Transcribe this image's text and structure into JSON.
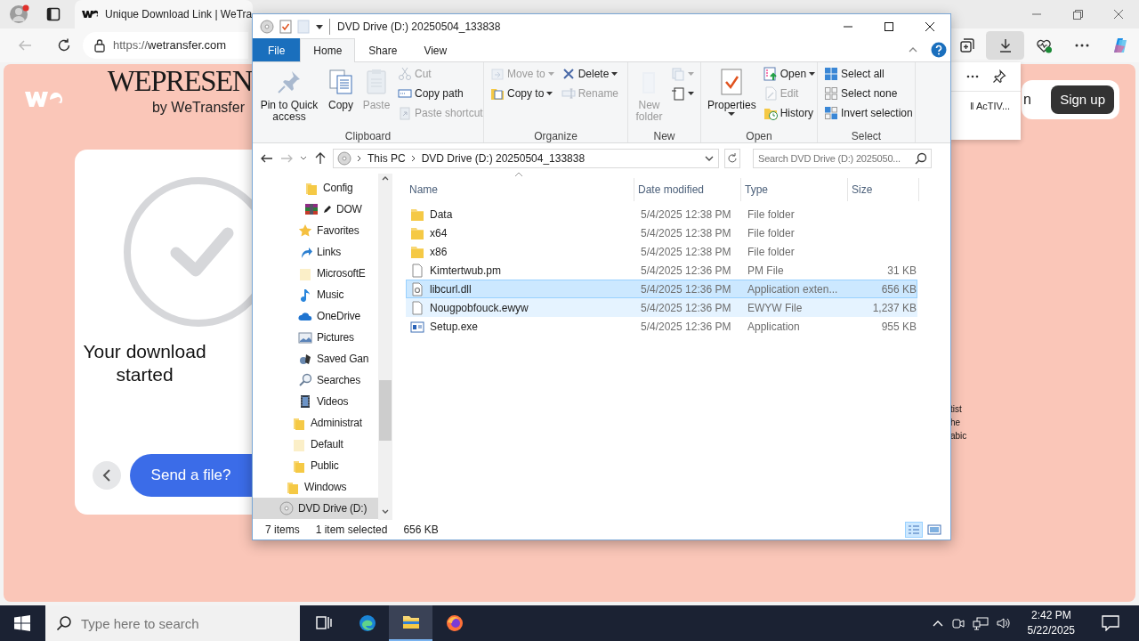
{
  "browser": {
    "tab_title": "Unique Download Link | WeTra",
    "url_scheme": "https://",
    "url_host": "wetransfer.com",
    "page": {
      "brand_title": "WEPRESEN",
      "brand_sub": "by WeTransfer",
      "heading": "Your download started",
      "send_button": "Send a file?",
      "header_partial": "n",
      "signup_button": "Sign up",
      "side_text": [
        "tist",
        "he",
        "abic"
      ]
    },
    "downloads_flyout": {
      "item": "‖ AcTIV..."
    }
  },
  "explorer": {
    "title": "DVD Drive (D:) 20250504_133838",
    "tabs": [
      {
        "label": "File",
        "kind": "file",
        "selected": false
      },
      {
        "label": "Home",
        "kind": "tab",
        "selected": true
      },
      {
        "label": "Share",
        "kind": "tab",
        "selected": false
      },
      {
        "label": "View",
        "kind": "tab",
        "selected": false
      }
    ],
    "ribbon": [
      {
        "label": "Clipboard",
        "columns": [
          [
            {
              "label": "Pin to Quick access",
              "kind": "large",
              "disabled": false,
              "dropdown": false
            }
          ],
          [
            {
              "label": "Copy",
              "kind": "large",
              "disabled": false,
              "dropdown": false
            }
          ],
          [
            {
              "label": "Paste",
              "kind": "large",
              "disabled": true,
              "dropdown": false
            }
          ],
          [
            {
              "label": "Cut",
              "kind": "small",
              "disabled": true,
              "dropdown": false
            },
            {
              "label": "Copy path",
              "kind": "small",
              "disabled": false,
              "dropdown": false
            },
            {
              "label": "Paste shortcut",
              "kind": "small",
              "disabled": true,
              "dropdown": false
            }
          ]
        ]
      },
      {
        "label": "Organize",
        "columns": [
          [
            {
              "label": "Move to",
              "kind": "small",
              "disabled": true,
              "dropdown": true
            },
            {
              "label": "Copy to",
              "kind": "small",
              "disabled": false,
              "dropdown": true
            }
          ],
          [
            {
              "label": "Delete",
              "kind": "small",
              "disabled": false,
              "dropdown": true
            },
            {
              "label": "Rename",
              "kind": "small",
              "disabled": true,
              "dropdown": false
            }
          ]
        ]
      },
      {
        "label": "New",
        "columns": [
          [
            {
              "label": "New folder",
              "kind": "large",
              "disabled": true,
              "dropdown": false
            }
          ],
          [
            {
              "kind": "small",
              "disabled": true,
              "dropdown": true
            },
            {
              "kind": "small",
              "disabled": false,
              "dropdown": true
            }
          ]
        ]
      },
      {
        "label": "Open",
        "columns": [
          [
            {
              "label": "Properties",
              "kind": "large",
              "disabled": false,
              "dropdown": true
            }
          ],
          [
            {
              "label": "Open",
              "kind": "small",
              "disabled": false,
              "dropdown": true
            },
            {
              "label": "Edit",
              "kind": "small",
              "disabled": true,
              "dropdown": false
            },
            {
              "label": "History",
              "kind": "small",
              "disabled": false,
              "dropdown": false
            }
          ]
        ]
      },
      {
        "label": "Select",
        "columns": [
          [
            {
              "label": "Select all",
              "kind": "small",
              "disabled": false,
              "dropdown": false
            },
            {
              "label": "Select none",
              "kind": "small",
              "disabled": false,
              "dropdown": false
            },
            {
              "label": "Invert selection",
              "kind": "small",
              "disabled": false,
              "dropdown": false
            }
          ]
        ]
      }
    ],
    "address": [
      "This PC",
      "DVD Drive (D:) 20250504_133838"
    ],
    "search": {
      "placeholder": "Search DVD Drive (D:) 2025050..."
    },
    "nav_tree": [
      {
        "children": [
          {
            "children": [
              {
                "children": [
                  {
                    "children": [
                      {
                        "label": "Config",
                        "kind": "folder",
                        "selected": false
                      },
                      {
                        "label": "DOW",
                        "kind": "archive",
                        "selected": false
                      }
                    ]
                  },
                  {
                    "label": "Favorites",
                    "kind": "favorites",
                    "selected": false
                  },
                  {
                    "label": "Links",
                    "kind": "links",
                    "selected": false
                  },
                  {
                    "label": "MicrosoftE",
                    "kind": "pale-folder",
                    "selected": false
                  },
                  {
                    "label": "Music",
                    "kind": "music",
                    "selected": false
                  },
                  {
                    "label": "OneDrive",
                    "kind": "cloud",
                    "selected": false
                  },
                  {
                    "label": "Pictures",
                    "kind": "pictures",
                    "selected": false
                  },
                  {
                    "label": "Saved Gan",
                    "kind": "games",
                    "selected": false
                  },
                  {
                    "label": "Searches",
                    "kind": "searches",
                    "selected": false
                  },
                  {
                    "label": "Videos",
                    "kind": "videos",
                    "selected": false
                  }
                ]
              },
              {
                "label": "Administrat",
                "kind": "folder",
                "selected": false
              },
              {
                "label": "Default",
                "kind": "pale-folder",
                "selected": false
              },
              {
                "label": "Public",
                "kind": "folder",
                "selected": false
              }
            ]
          },
          {
            "label": "Windows",
            "kind": "folder",
            "selected": false
          }
        ]
      },
      {
        "label": "DVD Drive (D:)",
        "kind": "drive",
        "selected": true
      }
    ],
    "columns": [
      "Name",
      "Date modified",
      "Type",
      "Size"
    ],
    "rows": [
      {
        "name": "Data",
        "date": "5/4/2025 12:38 PM",
        "type": "File folder",
        "kind": "folder",
        "selected": false,
        "hovered": false
      },
      {
        "name": "x64",
        "date": "5/4/2025 12:38 PM",
        "type": "File folder",
        "kind": "folder",
        "selected": false,
        "hovered": false
      },
      {
        "name": "x86",
        "date": "5/4/2025 12:38 PM",
        "type": "File folder",
        "kind": "folder",
        "selected": false,
        "hovered": false
      },
      {
        "name": "Kimtertwub.pm",
        "date": "5/4/2025 12:36 PM",
        "type": "PM File",
        "size": "31 KB",
        "kind": "file",
        "selected": false,
        "hovered": false
      },
      {
        "name": "libcurl.dll",
        "date": "5/4/2025 12:36 PM",
        "type": "Application exten...",
        "size": "656 KB",
        "kind": "dll",
        "selected": true,
        "hovered": false
      },
      {
        "name": "Nougpobfouck.ewyw",
        "date": "5/4/2025 12:36 PM",
        "type": "EWYW File",
        "size": "1,237 KB",
        "kind": "file",
        "selected": false,
        "hovered": true
      },
      {
        "name": "Setup.exe",
        "date": "5/4/2025 12:36 PM",
        "type": "Application",
        "size": "955 KB",
        "kind": "exe",
        "selected": false,
        "hovered": false
      }
    ],
    "status": {
      "count": "7 items",
      "selection": "1 item selected",
      "size": "656 KB"
    }
  },
  "taskbar": {
    "search_placeholder": "Type here to search",
    "time": "2:42 PM",
    "date": "5/22/2025"
  }
}
